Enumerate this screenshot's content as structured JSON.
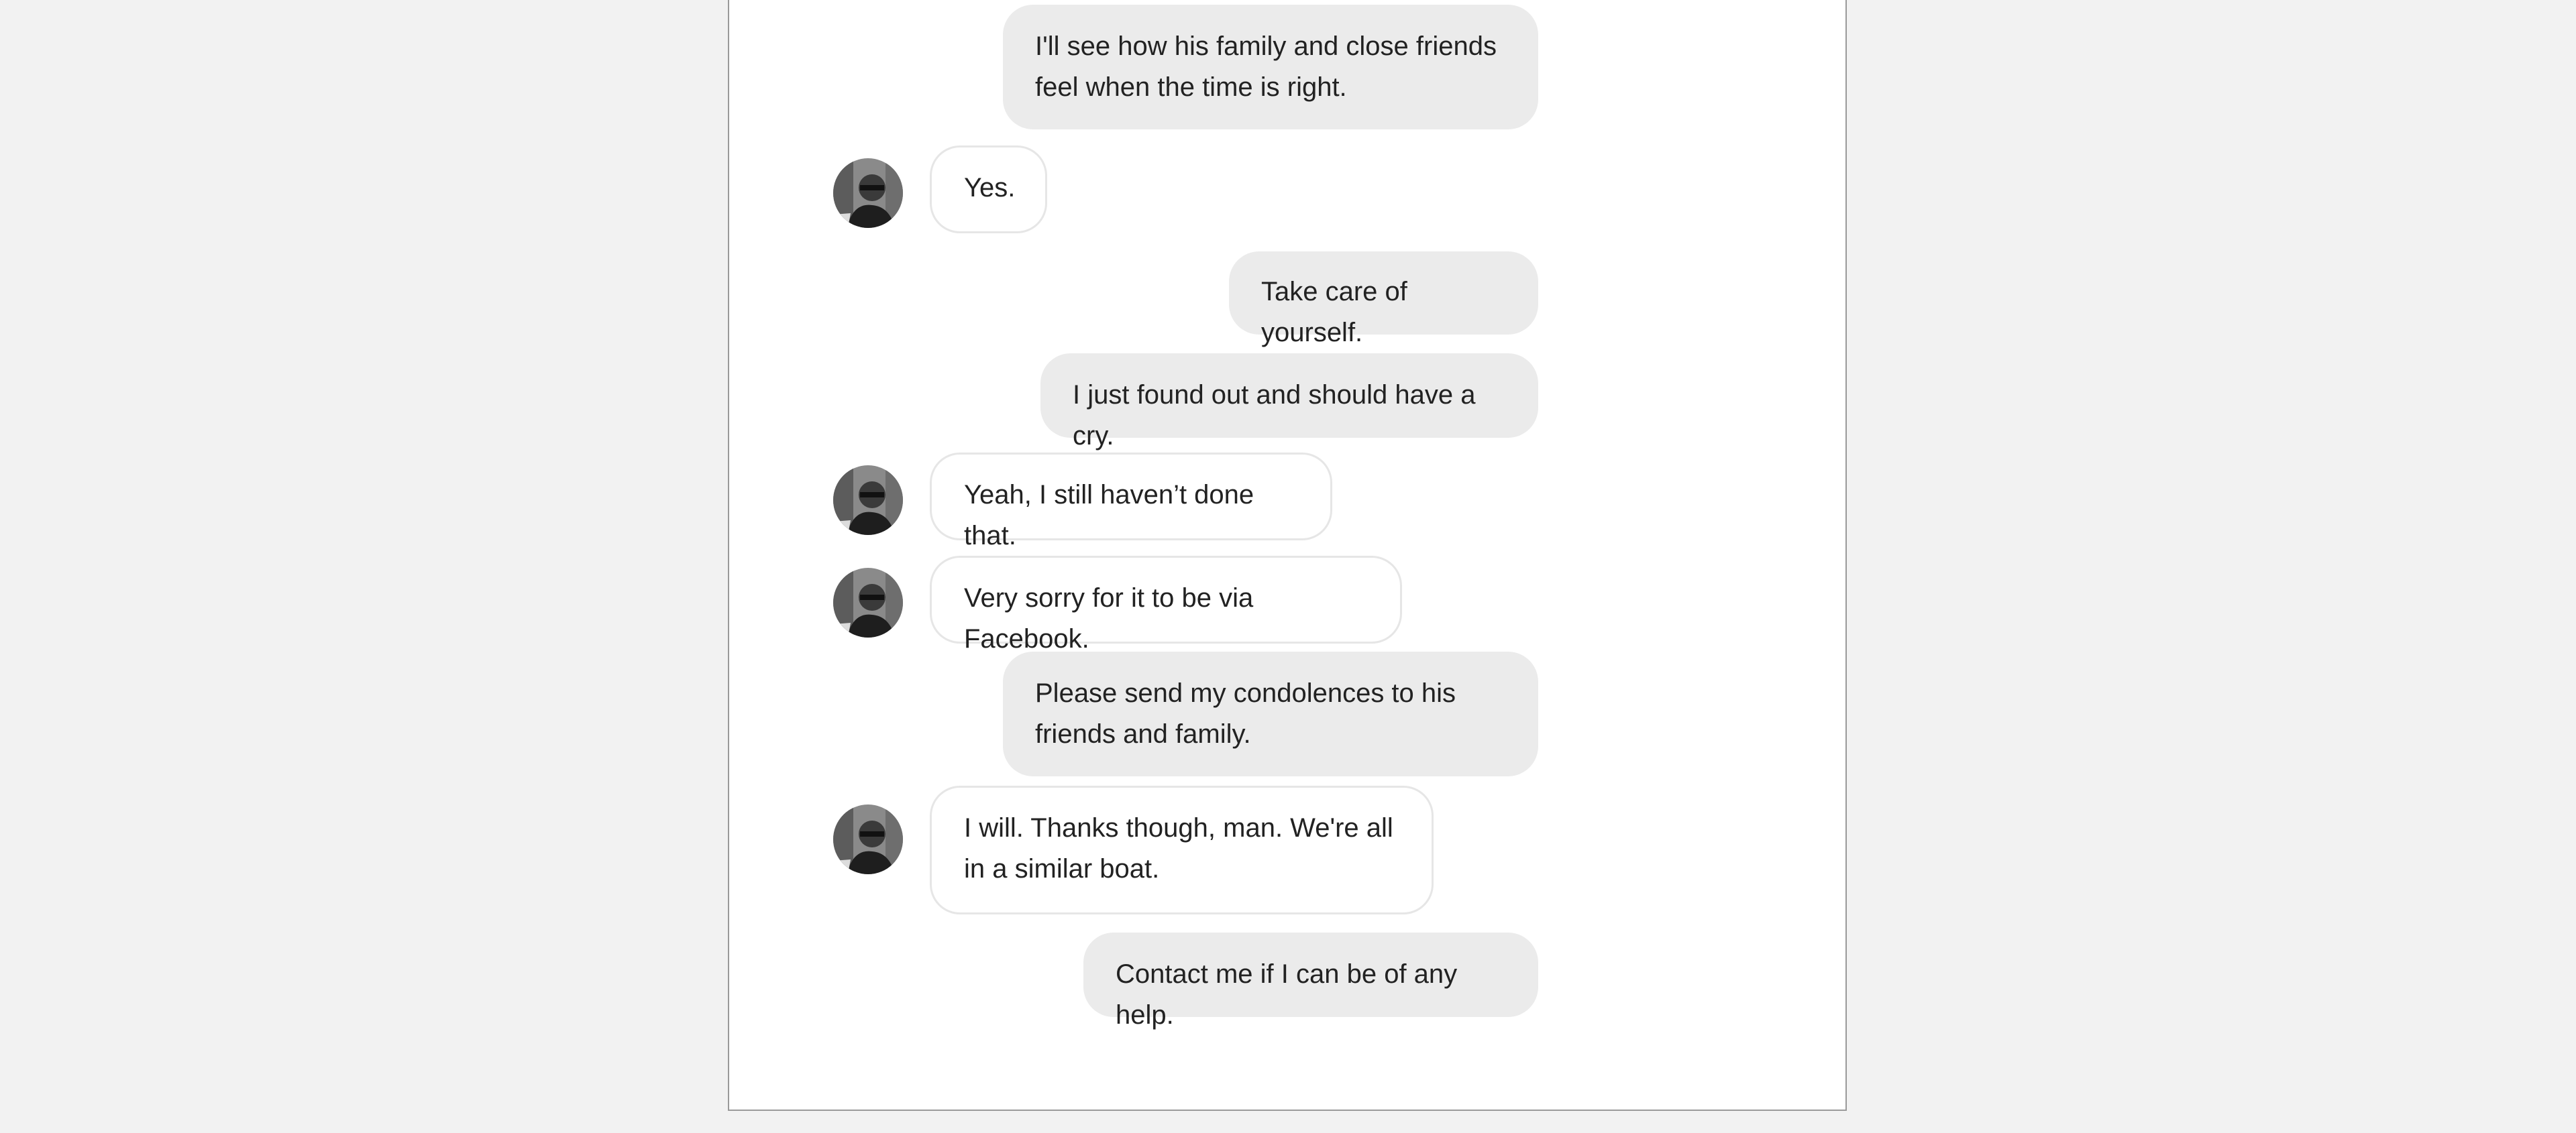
{
  "conversation": {
    "messages": [
      {
        "sender": "me",
        "text": "I'll see how his family and close friends feel when the time is right."
      },
      {
        "sender": "contact",
        "text": "Yes."
      },
      {
        "sender": "me",
        "text": "Take care of yourself."
      },
      {
        "sender": "me",
        "text": "I just found out and should have a cry."
      },
      {
        "sender": "contact",
        "text": "Yeah, I still haven’t done that."
      },
      {
        "sender": "contact",
        "text": "Very sorry for it to be via Facebook."
      },
      {
        "sender": "me",
        "text": "Please send my condolences to his friends and family."
      },
      {
        "sender": "contact",
        "text": "I will. Thanks though, man. We're all in a similar boat."
      },
      {
        "sender": "me",
        "text": "Contact me if I can be of any help."
      }
    ]
  },
  "theme": {
    "page_background": "#f2f2f2",
    "sent_bubble_color": "#ebebeb",
    "received_bubble_color": "#ffffff",
    "received_bubble_border": "#e6e6e6",
    "text_color": "#222222"
  },
  "icons": {
    "avatar": "contact-avatar-photo"
  }
}
